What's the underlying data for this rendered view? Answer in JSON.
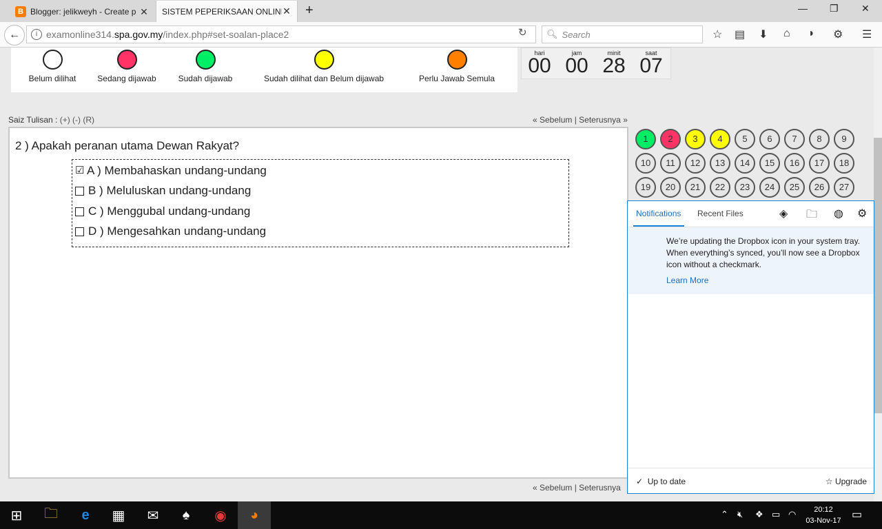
{
  "browser": {
    "tabs": [
      {
        "title": "Blogger: jelikweyh - Create p",
        "active": false
      },
      {
        "title": "SISTEM PEPERIKSAAN ONLINE (S",
        "active": true
      }
    ],
    "url_prefix": "examonline314.",
    "url_domain": "spa.gov.my",
    "url_path": "/index.php#set-soalan-place2",
    "search_placeholder": "Search"
  },
  "legend": [
    {
      "label": "Belum dilihat",
      "color": "#ffffff"
    },
    {
      "label": "Sedang dijawab",
      "color": "#ff3366"
    },
    {
      "label": "Sudah dijawab",
      "color": "#00ee66"
    },
    {
      "label": "Sudah dilihat dan Belum dijawab",
      "color": "#ffff00"
    },
    {
      "label": "Perlu Jawab Semula",
      "color": "#ff8000"
    }
  ],
  "timer": {
    "days_label": "hari",
    "days": "00",
    "hours_label": "jam",
    "hours": "00",
    "minutes_label": "minit",
    "minutes": "28",
    "seconds_label": "saat",
    "seconds": "07"
  },
  "font_size": {
    "label": "Saiz Tulisan :",
    "options": "(+) (-) (R)"
  },
  "navigation": {
    "text": "« Sebelum | Seterusnya »",
    "text_bottom": "« Sebelum | Seterusnya"
  },
  "question": {
    "text": "2 ) Apakah peranan utama Dewan Rakyat?",
    "answers": [
      {
        "label": "A ) Membahaskan undang-undang",
        "checked": true,
        "checkmark": "☑"
      },
      {
        "label": "B ) Meluluskan undang-undang",
        "checked": false,
        "checkmark": ""
      },
      {
        "label": "C ) Menggubal undang-undang",
        "checked": false,
        "checkmark": ""
      },
      {
        "label": "D ) Mengesahkan undang-undang",
        "checked": false,
        "checkmark": ""
      }
    ]
  },
  "question_grid": [
    {
      "n": "1",
      "color": "#00ee66"
    },
    {
      "n": "2",
      "color": "#ff3366"
    },
    {
      "n": "3",
      "color": "#ffff00"
    },
    {
      "n": "4",
      "color": "#ffff00"
    },
    {
      "n": "5",
      "color": "#e6e6e6"
    },
    {
      "n": "6",
      "color": "#e6e6e6"
    },
    {
      "n": "7",
      "color": "#e6e6e6"
    },
    {
      "n": "8",
      "color": "#e6e6e6"
    },
    {
      "n": "9",
      "color": "#e6e6e6"
    },
    {
      "n": "10",
      "color": "#e6e6e6"
    },
    {
      "n": "11",
      "color": "#e6e6e6"
    },
    {
      "n": "12",
      "color": "#e6e6e6"
    },
    {
      "n": "13",
      "color": "#e6e6e6"
    },
    {
      "n": "14",
      "color": "#e6e6e6"
    },
    {
      "n": "15",
      "color": "#e6e6e6"
    },
    {
      "n": "16",
      "color": "#e6e6e6"
    },
    {
      "n": "17",
      "color": "#e6e6e6"
    },
    {
      "n": "18",
      "color": "#e6e6e6"
    },
    {
      "n": "19",
      "color": "#e6e6e6"
    },
    {
      "n": "20",
      "color": "#e6e6e6"
    },
    {
      "n": "21",
      "color": "#e6e6e6"
    },
    {
      "n": "22",
      "color": "#e6e6e6"
    },
    {
      "n": "23",
      "color": "#e6e6e6"
    },
    {
      "n": "24",
      "color": "#e6e6e6"
    },
    {
      "n": "25",
      "color": "#e6e6e6"
    },
    {
      "n": "26",
      "color": "#e6e6e6"
    },
    {
      "n": "27",
      "color": "#e6e6e6"
    }
  ],
  "dropbox": {
    "tab_notifications": "Notifications",
    "tab_recent": "Recent Files",
    "message": "We’re updating the Dropbox icon in your system tray. When everything’s synced, you’ll now see a Dropbox icon without a checkmark.",
    "learn_more": "Learn More",
    "status": "Up to date",
    "upgrade": "Upgrade"
  },
  "taskbar": {
    "time": "20:12",
    "date": "03-Nov-17"
  }
}
